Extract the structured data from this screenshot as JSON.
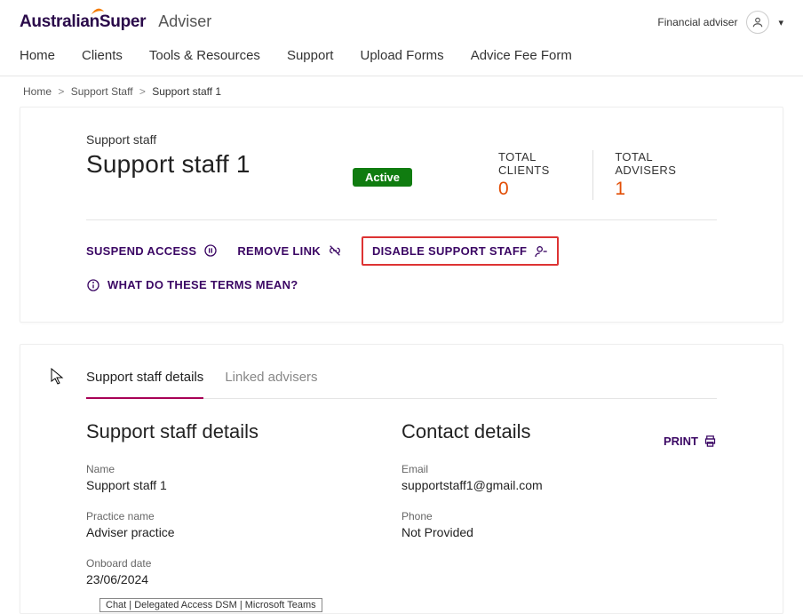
{
  "header": {
    "logo_main": "AustralianSuper",
    "logo_sub": "Adviser",
    "user_label": "Financial adviser"
  },
  "nav": {
    "items": [
      "Home",
      "Clients",
      "Tools & Resources",
      "Support",
      "Upload Forms",
      "Advice Fee Form"
    ]
  },
  "breadcrumb": {
    "items": [
      "Home",
      "Support Staff"
    ],
    "current": "Support staff 1"
  },
  "summary": {
    "kicker": "Support staff",
    "title": "Support staff 1",
    "status_badge": "Active",
    "stats": [
      {
        "label": "TOTAL CLIENTS",
        "value": "0"
      },
      {
        "label": "TOTAL ADVISERS",
        "value": "1"
      }
    ],
    "actions": {
      "suspend": "SUSPEND ACCESS",
      "remove_link": "REMOVE LINK",
      "disable": "DISABLE SUPPORT STAFF"
    },
    "help": "WHAT DO THESE TERMS MEAN?"
  },
  "tabs": {
    "items": [
      {
        "label": "Support staff details",
        "active": true
      },
      {
        "label": "Linked advisers",
        "active": false
      }
    ]
  },
  "details": {
    "left_heading": "Support staff details",
    "right_heading": "Contact details",
    "print_label": "PRINT",
    "fields_left": {
      "name_label": "Name",
      "name_value": "Support staff 1",
      "practice_label": "Practice name",
      "practice_value": "Adviser practice",
      "onboard_label": "Onboard date",
      "onboard_value": "23/06/2024"
    },
    "fields_right": {
      "email_label": "Email",
      "email_value": "supportstaff1@gmail.com",
      "phone_label": "Phone",
      "phone_value": "Not Provided"
    }
  },
  "chat_pill": "Chat | Delegated Access DSM | Microsoft Teams"
}
